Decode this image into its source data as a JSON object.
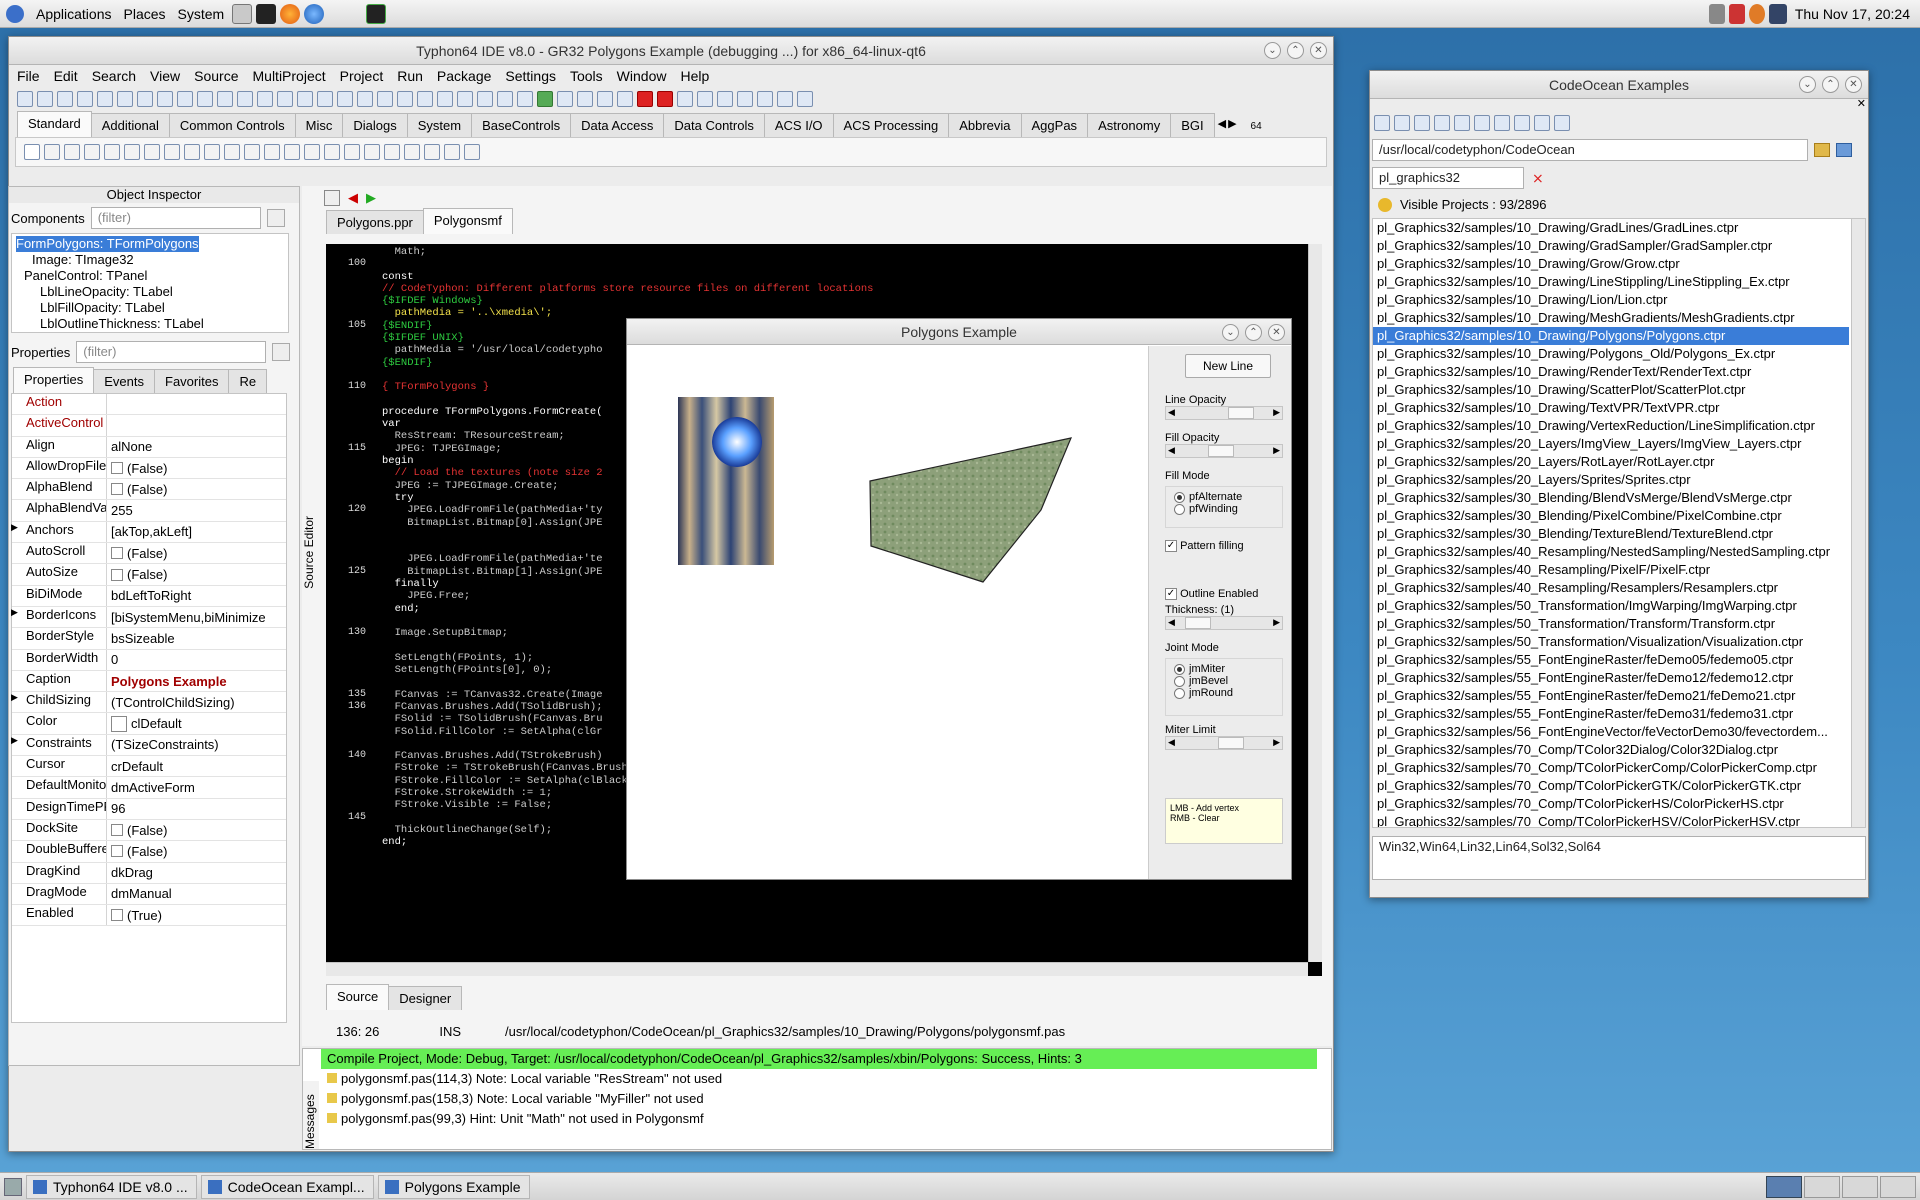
{
  "topbar": {
    "menus": [
      "Applications",
      "Places",
      "System"
    ],
    "clock": "Thu Nov 17, 20:24"
  },
  "ide": {
    "title": "Typhon64 IDE v8.0 - GR32 Polygons Example (debugging ...) for x86_64-linux-qt6",
    "menu": [
      "File",
      "Edit",
      "Search",
      "View",
      "Source",
      "MultiProject",
      "Project",
      "Run",
      "Package",
      "Settings",
      "Tools",
      "Window",
      "Help"
    ],
    "palette_tabs": [
      "Standard",
      "Additional",
      "Common Controls",
      "Misc",
      "Dialogs",
      "System",
      "BaseControls",
      "Data Access",
      "Data Controls",
      "ACS I/O",
      "ACS Processing",
      "Abbrevia",
      "AggPas",
      "Astronomy",
      "BGI"
    ],
    "palette_counter": "64"
  },
  "inspector": {
    "title": "Object Inspector",
    "components_label": "Components",
    "filter_placeholder": "(filter)",
    "properties_label": "Properties",
    "tree": [
      "FormPolygons: TFormPolygons",
      "Image: TImage32",
      "PanelControl: TPanel",
      "LblLineOpacity: TLabel",
      "LblFillOpacity: TLabel",
      "LblOutlineThickness: TLabel"
    ],
    "tabs": [
      "Properties",
      "Events",
      "Favorites",
      "Re"
    ],
    "props": [
      {
        "k": "Action",
        "v": "",
        "red": true
      },
      {
        "k": "ActiveControl",
        "v": "",
        "red": true
      },
      {
        "k": "Align",
        "v": "alNone"
      },
      {
        "k": "AllowDropFiles",
        "v": "(False)",
        "cb": true
      },
      {
        "k": "AlphaBlend",
        "v": "(False)",
        "cb": true
      },
      {
        "k": "AlphaBlendValue",
        "v": "255"
      },
      {
        "k": "Anchors",
        "v": "[akTop,akLeft]",
        "exp": true
      },
      {
        "k": "AutoScroll",
        "v": "(False)",
        "cb": true
      },
      {
        "k": "AutoSize",
        "v": "(False)",
        "cb": true
      },
      {
        "k": "BiDiMode",
        "v": "bdLeftToRight"
      },
      {
        "k": "BorderIcons",
        "v": "[biSystemMenu,biMinimize",
        "exp": true
      },
      {
        "k": "BorderStyle",
        "v": "bsSizeable"
      },
      {
        "k": "BorderWidth",
        "v": "0"
      },
      {
        "k": "Caption",
        "v": "Polygons Example",
        "bold": true
      },
      {
        "k": "ChildSizing",
        "v": "(TControlChildSizing)",
        "exp": true
      },
      {
        "k": "Color",
        "v": "clDefault",
        "sw": true
      },
      {
        "k": "Constraints",
        "v": "(TSizeConstraints)",
        "exp": true
      },
      {
        "k": "Cursor",
        "v": "crDefault"
      },
      {
        "k": "DefaultMonitor",
        "v": "dmActiveForm"
      },
      {
        "k": "DesignTimePPI",
        "v": "96"
      },
      {
        "k": "DockSite",
        "v": "(False)",
        "cb": true
      },
      {
        "k": "DoubleBuffered",
        "v": "(False)",
        "cb": true
      },
      {
        "k": "DragKind",
        "v": "dkDrag"
      },
      {
        "k": "DragMode",
        "v": "dmManual"
      },
      {
        "k": "Enabled",
        "v": "(True)",
        "cb": true
      }
    ]
  },
  "editor": {
    "tabs": [
      "Polygons.ppr",
      "Polygonsmf"
    ],
    "side_label": "Source Editor",
    "bottom_tabs": [
      "Source",
      "Designer"
    ],
    "status": {
      "pos": "136: 26",
      "mode": "INS",
      "file": "/usr/local/codetyphon/CodeOcean/pl_Graphics32/samples/10_Drawing/Polygons/polygonsmf.pas"
    },
    "gutter": [
      "",
      "100",
      "",
      "",
      "",
      "",
      "105",
      "",
      "",
      "",
      "",
      "110",
      "",
      "",
      "",
      "",
      "115",
      "",
      "",
      "",
      "",
      "120",
      "",
      "",
      "",
      "",
      "125",
      "",
      "",
      "",
      "",
      "130",
      "",
      "",
      "",
      "",
      "135",
      "136",
      "",
      "",
      "",
      "140",
      "",
      "",
      "",
      "",
      "145",
      ""
    ],
    "lines": [
      [
        "def",
        "  Math;"
      ],
      [
        "def",
        ""
      ],
      [
        "kw",
        "const"
      ],
      [
        "com",
        "// CodeTyphon: Different platforms store resource files on different locations"
      ],
      [
        "dir",
        "{$IFDEF Windows}"
      ],
      [
        "str",
        "  pathMedia = '..\\xmedia\\';"
      ],
      [
        "dir",
        "{$ENDIF}"
      ],
      [
        "dir",
        "{$IFDEF UNIX}"
      ],
      [
        "mix",
        "  pathMedia = '/usr/local/codetypho"
      ],
      [
        "dir",
        "{$ENDIF}"
      ],
      [
        "def",
        ""
      ],
      [
        "com",
        "{ TFormPolygons }"
      ],
      [
        "def",
        ""
      ],
      [
        "kw",
        "procedure TFormPolygons.FormCreate("
      ],
      [
        "kw",
        "var"
      ],
      [
        "def",
        "  ResStream: TResourceStream;"
      ],
      [
        "def",
        "  JPEG: TJPEGImage;"
      ],
      [
        "kw",
        "begin"
      ],
      [
        "com",
        "  // Load the textures (note size 2"
      ],
      [
        "def",
        "  JPEG := TJPEGImage.Create;"
      ],
      [
        "kw",
        "  try"
      ],
      [
        "def",
        "    JPEG.LoadFromFile(pathMedia+'ty"
      ],
      [
        "def",
        "    BitmapList.Bitmap[0].Assign(JPE"
      ],
      [
        "def",
        ""
      ],
      [
        "def",
        ""
      ],
      [
        "def",
        "    JPEG.LoadFromFile(pathMedia+'te"
      ],
      [
        "def",
        "    BitmapList.Bitmap[1].Assign(JPE"
      ],
      [
        "kw",
        "  finally"
      ],
      [
        "def",
        "    JPEG.Free;"
      ],
      [
        "kw",
        "  end;"
      ],
      [
        "def",
        ""
      ],
      [
        "def",
        "  Image.SetupBitmap;"
      ],
      [
        "def",
        ""
      ],
      [
        "def",
        "  SetLength(FPoints, 1);"
      ],
      [
        "def",
        "  SetLength(FPoints[0], 0);"
      ],
      [
        "def",
        ""
      ],
      [
        "def",
        "  FCanvas := TCanvas32.Create(Image"
      ],
      [
        "def",
        "  FCanvas.Brushes.Add(TSolidBrush);"
      ],
      [
        "def",
        "  FSolid := TSolidBrush(FCanvas.Bru"
      ],
      [
        "def",
        "  FSolid.FillColor := SetAlpha(clGr"
      ],
      [
        "def",
        ""
      ],
      [
        "def",
        "  FCanvas.Brushes.Add(TStrokeBrush)"
      ],
      [
        "def",
        "  FStroke := TStrokeBrush(FCanvas.Brushes[1]);"
      ],
      [
        "def",
        "  FStroke.FillColor := SetAlpha(clBlack32, LineAlpha.Position);"
      ],
      [
        "def",
        "  FStroke.StrokeWidth := 1;"
      ],
      [
        "def",
        "  FStroke.Visible := False;"
      ],
      [
        "def",
        ""
      ],
      [
        "def",
        "  ThickOutlineChange(Self);"
      ],
      [
        "kw",
        "end;"
      ]
    ]
  },
  "messages": {
    "side_label": "Messages",
    "compile": "Compile Project, Mode: Debug, Target: /usr/local/codetyphon/CodeOcean/pl_Graphics32/samples/xbin/Polygons: Success, Hints: 3",
    "items": [
      "polygonsmf.pas(114,3) Note: Local variable \"ResStream\" not used",
      "polygonsmf.pas(158,3) Note: Local variable \"MyFiller\" not used",
      "polygonsmf.pas(99,3) Hint: Unit \"Math\" not used in Polygonsmf"
    ]
  },
  "example": {
    "title": "Polygons Example",
    "new_line": "New Line",
    "line_opacity": "Line Opacity",
    "fill_opacity": "Fill Opacity",
    "line_opacity_value": 0.75,
    "fill_opacity_value": 0.45,
    "fill_mode": "Fill Mode",
    "pf_alternate": "pfAlternate",
    "pf_winding": "pfWinding",
    "pattern_filling": "Pattern filling",
    "outline_enabled": "Outline Enabled",
    "thickness": "Thickness: (1)",
    "thickness_value": 0.1,
    "joint_mode": "Joint Mode",
    "jm_miter": "jmMiter",
    "jm_bevel": "jmBevel",
    "jm_round": "jmRound",
    "miter_limit": "Miter Limit",
    "miter_limit_value": 0.6,
    "hint1": "LMB - Add vertex",
    "hint2": "RMB - Clear"
  },
  "codeocean": {
    "title": "CodeOcean Examples",
    "path": "/usr/local/codetyphon/CodeOcean",
    "search": "pl_graphics32",
    "visible": "Visible Projects : 93/2896",
    "projects": [
      "pl_Graphics32/samples/10_Drawing/GradLines/GradLines.ctpr",
      "pl_Graphics32/samples/10_Drawing/GradSampler/GradSampler.ctpr",
      "pl_Graphics32/samples/10_Drawing/Grow/Grow.ctpr",
      "pl_Graphics32/samples/10_Drawing/LineStippling/LineStippling_Ex.ctpr",
      "pl_Graphics32/samples/10_Drawing/Lion/Lion.ctpr",
      "pl_Graphics32/samples/10_Drawing/MeshGradients/MeshGradients.ctpr",
      "pl_Graphics32/samples/10_Drawing/Polygons/Polygons.ctpr",
      "pl_Graphics32/samples/10_Drawing/Polygons_Old/Polygons_Ex.ctpr",
      "pl_Graphics32/samples/10_Drawing/RenderText/RenderText.ctpr",
      "pl_Graphics32/samples/10_Drawing/ScatterPlot/ScatterPlot.ctpr",
      "pl_Graphics32/samples/10_Drawing/TextVPR/TextVPR.ctpr",
      "pl_Graphics32/samples/10_Drawing/VertexReduction/LineSimplification.ctpr",
      "pl_Graphics32/samples/20_Layers/ImgView_Layers/ImgView_Layers.ctpr",
      "pl_Graphics32/samples/20_Layers/RotLayer/RotLayer.ctpr",
      "pl_Graphics32/samples/20_Layers/Sprites/Sprites.ctpr",
      "pl_Graphics32/samples/30_Blending/BlendVsMerge/BlendVsMerge.ctpr",
      "pl_Graphics32/samples/30_Blending/PixelCombine/PixelCombine.ctpr",
      "pl_Graphics32/samples/30_Blending/TextureBlend/TextureBlend.ctpr",
      "pl_Graphics32/samples/40_Resampling/NestedSampling/NestedSampling.ctpr",
      "pl_Graphics32/samples/40_Resampling/PixelF/PixelF.ctpr",
      "pl_Graphics32/samples/40_Resampling/Resamplers/Resamplers.ctpr",
      "pl_Graphics32/samples/50_Transformation/ImgWarping/ImgWarping.ctpr",
      "pl_Graphics32/samples/50_Transformation/Transform/Transform.ctpr",
      "pl_Graphics32/samples/50_Transformation/Visualization/Visualization.ctpr",
      "pl_Graphics32/samples/55_FontEngineRaster/feDemo05/fedemo05.ctpr",
      "pl_Graphics32/samples/55_FontEngineRaster/feDemo12/fedemo12.ctpr",
      "pl_Graphics32/samples/55_FontEngineRaster/feDemo21/feDemo21.ctpr",
      "pl_Graphics32/samples/55_FontEngineRaster/feDemo31/fedemo31.ctpr",
      "pl_Graphics32/samples/56_FontEngineVector/feVectorDemo30/fevectordem...",
      "pl_Graphics32/samples/70_Comp/TColor32Dialog/Color32Dialog.ctpr",
      "pl_Graphics32/samples/70_Comp/TColorPickerComp/ColorPickerComp.ctpr",
      "pl_Graphics32/samples/70_Comp/TColorPickerGTK/ColorPickerGTK.ctpr",
      "pl_Graphics32/samples/70_Comp/TColorPickerHS/ColorPickerHS.ctpr",
      "pl_Graphics32/samples/70_Comp/TColorPickerHSV/ColorPickerHSV.ctpr"
    ],
    "platforms": "Win32,Win64,Lin32,Lin64,Sol32,Sol64"
  },
  "taskbar": [
    "Typhon64 IDE v8.0 ...",
    "CodeOcean Exampl...",
    "Polygons Example"
  ]
}
